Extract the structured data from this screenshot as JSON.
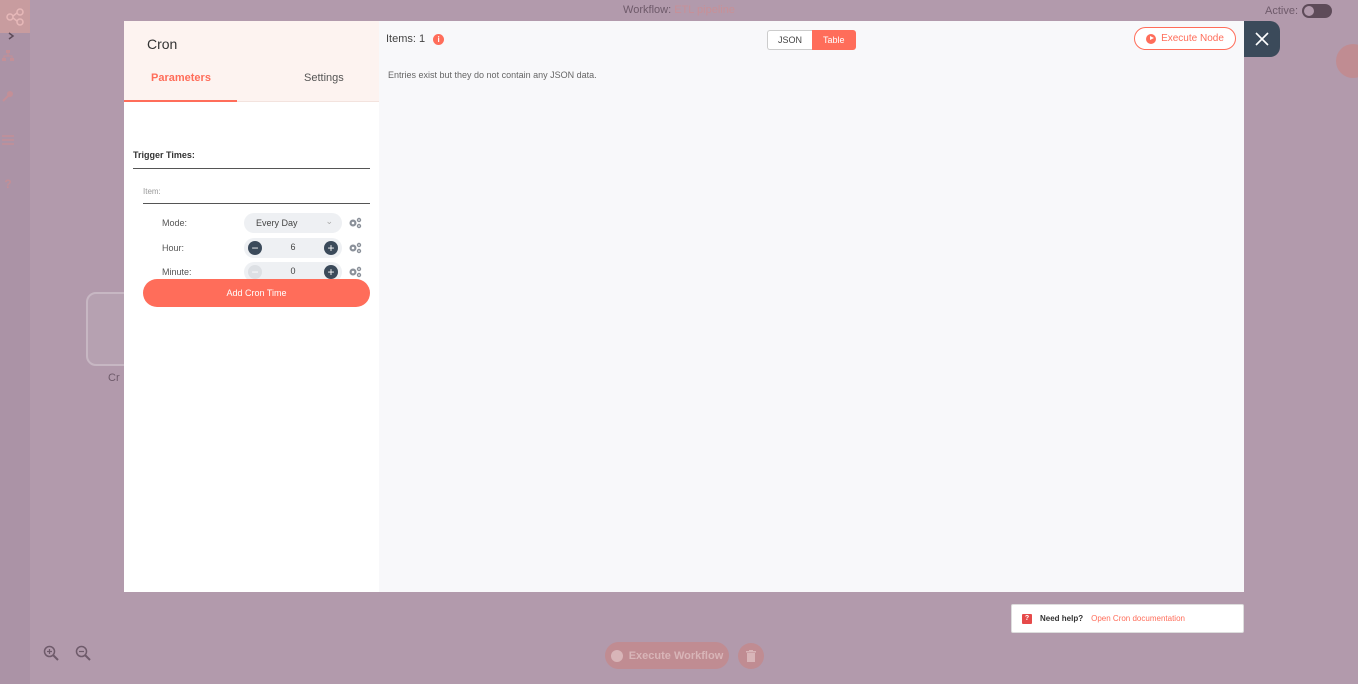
{
  "background": {
    "workflow_label": "Workflow:",
    "workflow_name": "ETL pipeline",
    "active_label": "Active:",
    "node_label": "Cr",
    "execute_workflow_label": "Execute Workflow"
  },
  "modal": {
    "node_title": "Cron",
    "tabs": {
      "parameters": "Parameters",
      "settings": "Settings"
    },
    "trigger_times_label": "Trigger Times:",
    "item_label": "Item:",
    "mode": {
      "label": "Mode:",
      "value": "Every Day"
    },
    "hour": {
      "label": "Hour:",
      "value": "6"
    },
    "minute": {
      "label": "Minute:",
      "value": "0"
    },
    "add_cron_label": "Add Cron Time"
  },
  "output": {
    "items_label": "Items: 1",
    "view_json": "JSON",
    "view_table": "Table",
    "execute_node_label": "Execute Node",
    "empty_message": "Entries exist but they do not contain any JSON data."
  },
  "help": {
    "prefix": "Need help?",
    "link": "Open Cron documentation"
  },
  "colors": {
    "accent": "#ff6d5a",
    "dark": "#3b4a5a",
    "overlay": "#b29aac"
  }
}
